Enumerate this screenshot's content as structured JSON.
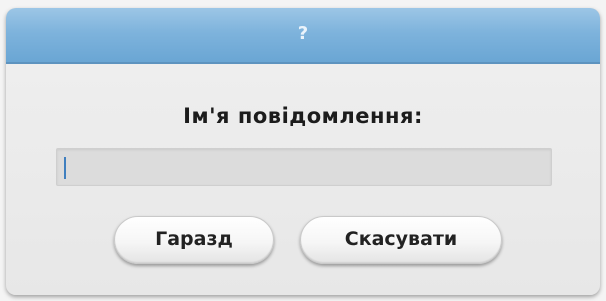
{
  "dialog": {
    "title": "?",
    "prompt": "Ім'я повідомлення:",
    "input_value": "",
    "ok_label": "Гаразд",
    "cancel_label": "Скасувати"
  },
  "colors": {
    "titlebar": "#7eb3dc",
    "background": "#e9e9e9",
    "input_background": "#dcdcdc",
    "caret": "#3f7fbf"
  }
}
